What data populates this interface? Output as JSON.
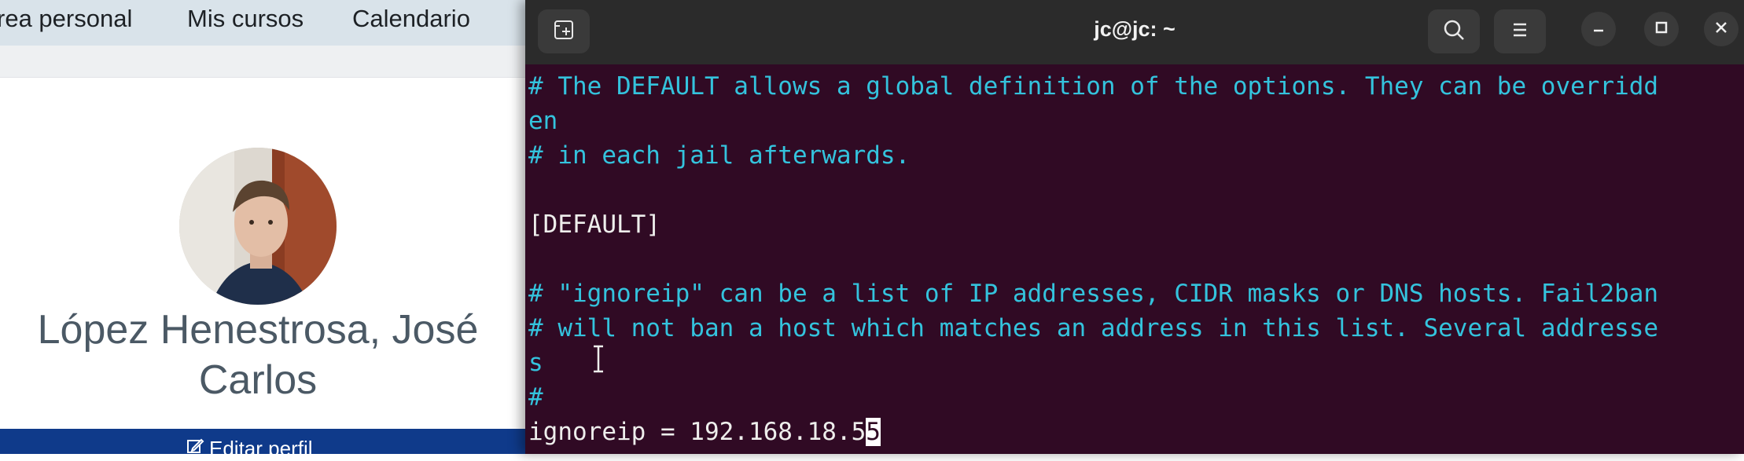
{
  "moodle": {
    "nav": [
      "rea personal",
      "Mis cursos",
      "Calendario"
    ],
    "profile": {
      "name_line1": "López Henestrosa, José",
      "name_line2": "Carlos",
      "edit_button": "Editar perfil"
    }
  },
  "terminal": {
    "title": "jc@jc: ~",
    "lines": [
      {
        "text": "# The DEFAULT allows a global definition of the options. They can be overridd",
        "style": "comment"
      },
      {
        "text": "en",
        "style": "comment"
      },
      {
        "text": "# in each jail afterwards.",
        "style": "comment"
      },
      {
        "text": "",
        "style": "blank"
      },
      {
        "text": "[DEFAULT]",
        "style": "plain"
      },
      {
        "text": "",
        "style": "blank"
      },
      {
        "text": "# \"ignoreip\" can be a list of IP addresses, CIDR masks or DNS hosts. Fail2ban",
        "style": "comment"
      },
      {
        "text": "# will not ban a host which matches an address in this list. Several addresse",
        "style": "comment"
      },
      {
        "text": "s",
        "style": "comment"
      },
      {
        "text": "#",
        "style": "comment"
      }
    ],
    "input_line": {
      "text": "ignoreip = 192.168.18.5",
      "cursor_char": "5"
    }
  },
  "colors": {
    "terminal_bg": "#300a24",
    "comment": "#34c3dd",
    "plain": "#eeeeec",
    "titlebar": "#2b2b2b",
    "moodle_nav": "#d9e3ea",
    "edit_bar": "#0f3a8a"
  }
}
